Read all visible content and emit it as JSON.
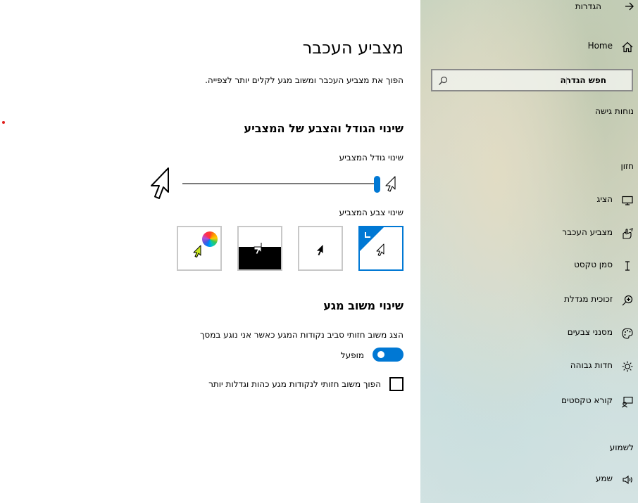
{
  "app": {
    "title": "הגדרות",
    "back_icon": "back-arrow-icon"
  },
  "sidebar": {
    "home_label": "Home",
    "search_label": "חפש הגדרה",
    "search_icon": "search-icon",
    "accessibility_heading": "נוחות גישה",
    "vision_heading": "חזון",
    "hearing_heading": "לשמוע",
    "items": [
      {
        "label": "הציג",
        "icon": "monitor-icon"
      },
      {
        "label": "מצביע העכבר",
        "icon": "pointer-hand-icon"
      },
      {
        "label": "סמן טקסט",
        "icon": "text-cursor-icon"
      },
      {
        "label": "זכוכית מגדלת",
        "icon": "magnifier-icon"
      },
      {
        "label": "מסנני צבעים",
        "icon": "palette-icon"
      },
      {
        "label": "חדות גבוהה",
        "icon": "brightness-icon"
      },
      {
        "label": "קורא טקסטים",
        "icon": "narrator-icon"
      },
      {
        "label": "שמע",
        "icon": "speaker-icon"
      }
    ]
  },
  "main": {
    "title": "מצביע העכבר",
    "description": "הפוך את מצביע העכבר ומשוב מגע לקלים יותר לצפייה.",
    "size_color_heading": "שינוי הגודל והצבע של המצביע",
    "size_label": "שינוי גודל המצביע",
    "pointer_size_level": 0.99,
    "color_label": "שינוי צבע המצביע",
    "color_options": [
      {
        "name": "white",
        "selected": true
      },
      {
        "name": "black",
        "selected": false
      },
      {
        "name": "inverted",
        "selected": false
      },
      {
        "name": "custom",
        "selected": false
      }
    ],
    "touch_heading": "שינוי משוב מגע",
    "touch_label": "הצג משוב חזותי סביב נקודות המגע כאשר אני נוגע במסך",
    "toggle_state": "מופעל",
    "toggle_on": true,
    "checkbox_label": "הפוך משוב חזותי לנקודות מגע כהות וגדלות יותר",
    "checkbox_checked": false
  },
  "colors": {
    "accent": "#0078d4",
    "custom_cursor": "#c8e61e"
  }
}
